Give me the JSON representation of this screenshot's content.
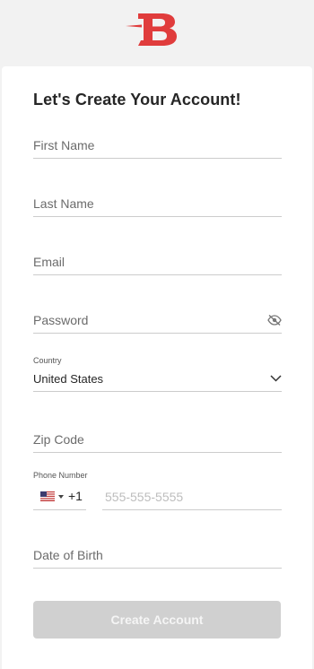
{
  "brand": {
    "logo_icon": "brand-b-logo",
    "accent_color": "#e03c3c"
  },
  "form": {
    "title": "Let's Create Your Account!",
    "first_name": {
      "placeholder": "First Name",
      "value": ""
    },
    "last_name": {
      "placeholder": "Last Name",
      "value": ""
    },
    "email": {
      "placeholder": "Email",
      "value": ""
    },
    "password": {
      "placeholder": "Password",
      "value": "",
      "toggle_icon": "eye-slash-icon"
    },
    "country": {
      "label": "Country",
      "value": "United States",
      "icon": "chevron-down-icon"
    },
    "zip": {
      "placeholder": "Zip Code",
      "value": ""
    },
    "phone": {
      "label": "Phone Number",
      "flag_icon": "us-flag-icon",
      "dial_code": "+1",
      "placeholder": "555-555-5555",
      "value": ""
    },
    "dob": {
      "placeholder": "Date of Birth",
      "value": ""
    },
    "submit_label": "Create Account",
    "submit_color": "#d0d0d0"
  }
}
